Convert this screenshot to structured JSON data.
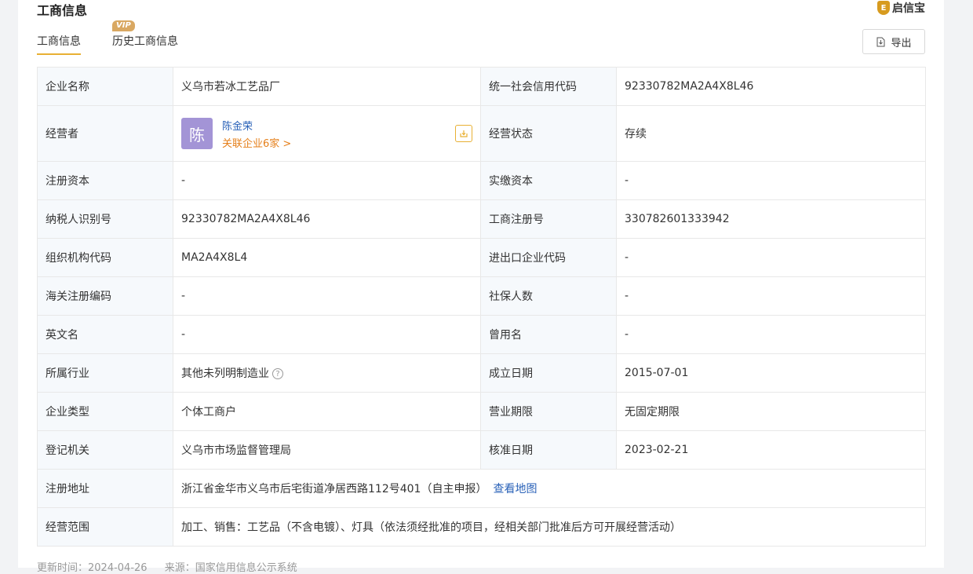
{
  "header": {
    "title": "工商信息",
    "logo_text": "启信宝",
    "logo_mark": "E"
  },
  "tabs": [
    {
      "label": "工商信息",
      "active": true
    },
    {
      "label": "历史工商信息",
      "badge": "VIP"
    }
  ],
  "toolbar": {
    "export_label": "导出"
  },
  "rows": [
    {
      "l1": "企业名称",
      "v1": "义乌市若冰工艺品厂",
      "l2": "统一社会信用代码",
      "v2": "92330782MA2A4X8L46"
    },
    {
      "l1": "经营者",
      "person": {
        "avatar": "陈",
        "name": "陈金荣",
        "link": "关联企业6家 >"
      },
      "l2": "经营状态",
      "v2": "存续"
    },
    {
      "l1": "注册资本",
      "v1": "-",
      "l2": "实缴资本",
      "v2": "-"
    },
    {
      "l1": "纳税人识别号",
      "v1": "92330782MA2A4X8L46",
      "l2": "工商注册号",
      "v2": "330782601333942"
    },
    {
      "l1": "组织机构代码",
      "v1": "MA2A4X8L4",
      "l2": "进出口企业代码",
      "v2": "-"
    },
    {
      "l1": "海关注册编码",
      "v1": "-",
      "l2": "社保人数",
      "v2": "-"
    },
    {
      "l1": "英文名",
      "v1": "-",
      "l2": "曾用名",
      "v2": "-"
    },
    {
      "l1": "所属行业",
      "v1": "其他未列明制造业",
      "l2": "成立日期",
      "v2": "2015-07-01"
    },
    {
      "l1": "企业类型",
      "v1": "个体工商户",
      "l2": "营业期限",
      "v2": "无固定期限"
    },
    {
      "l1": "登记机关",
      "v1": "义乌市市场监督管理局",
      "l2": "核准日期",
      "v2": "2023-02-21"
    }
  ],
  "address": {
    "label": "注册地址",
    "value": "浙江省金华市义乌市后宅街道净居西路112号401（自主申报）",
    "map_link": "查看地图"
  },
  "scope": {
    "label": "经营范围",
    "value": "加工、销售：工艺品（不含电镀）、灯具（依法须经批准的项目，经相关部门批准后方可开展经营活动）"
  },
  "footer": {
    "updated": "更新时间：2024-04-26",
    "source": "来源：国家信用信息公示系统"
  }
}
